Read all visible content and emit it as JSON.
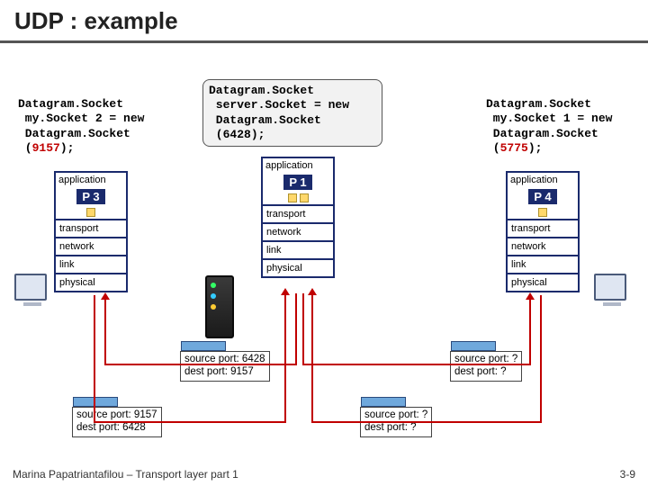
{
  "title": "UDP : example",
  "code_left": "Datagram.Socket\n my.Socket 2 = new\n Datagram.Socket\n (",
  "port_left": "9157",
  "code_left_end": ");",
  "code_server_a": "Datagram.Socket\n server.Socket = new\n Datagram.Socket\n (",
  "port_server": "6428",
  "code_server_end": ");",
  "code_right": "Datagram.Socket\n my.Socket 1 = new\n Datagram.Socket\n (",
  "port_right": "5775",
  "code_right_end": ");",
  "stack": {
    "application": "application",
    "transport": "transport",
    "network": "network",
    "link": "link",
    "physical": "physical"
  },
  "p_left": "P 3",
  "p_center": "P 1",
  "p_right": "P 4",
  "dgram_left_down": {
    "l1": "source port: 9157",
    "l2": "dest port: 6428"
  },
  "dgram_center_up": {
    "l1": "source port: 6428",
    "l2": "dest port: 9157"
  },
  "dgram_center_right": {
    "l1": "source port: ?",
    "l2": "dest port: ?"
  },
  "dgram_right_up": {
    "l1": "source port: ?",
    "l2": "dest port: ?"
  },
  "footer": "Marina Papatriantafilou – Transport layer part 1",
  "pagenum": "3-9"
}
